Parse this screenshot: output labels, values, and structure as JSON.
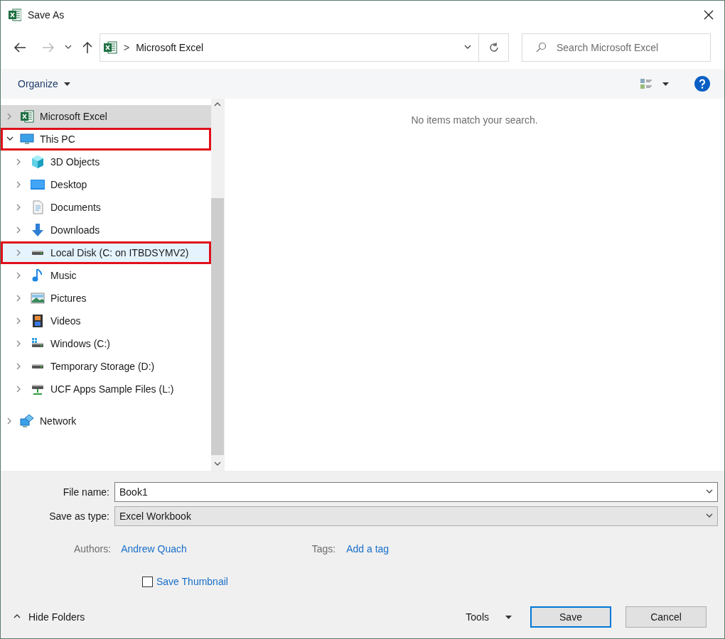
{
  "window": {
    "title": "Save As"
  },
  "address_bar": {
    "separator": ">",
    "location": "Microsoft Excel"
  },
  "search": {
    "placeholder": "Search Microsoft Excel"
  },
  "toolbar": {
    "organize": "Organize"
  },
  "nav_tree": [
    {
      "label": "Microsoft Excel",
      "kind": "excel",
      "expanded": false,
      "selected": true,
      "hot": false,
      "marked": false
    },
    {
      "label": "This PC",
      "kind": "pc",
      "expanded": true,
      "selected": false,
      "hot": false,
      "marked": true,
      "children": [
        {
          "label": "3D Objects",
          "kind": "objects3d",
          "expanded": false,
          "selected": false,
          "hot": false,
          "marked": false
        },
        {
          "label": "Desktop",
          "kind": "desktop",
          "expanded": false,
          "selected": false,
          "hot": false,
          "marked": false
        },
        {
          "label": "Documents",
          "kind": "documents",
          "expanded": false,
          "selected": false,
          "hot": false,
          "marked": false
        },
        {
          "label": "Downloads",
          "kind": "downloads",
          "expanded": false,
          "selected": false,
          "hot": false,
          "marked": false
        },
        {
          "label": "Local Disk (C: on ITBDSYMV2)",
          "kind": "disk",
          "expanded": false,
          "selected": false,
          "hot": true,
          "marked": true
        },
        {
          "label": "Music",
          "kind": "music",
          "expanded": false,
          "selected": false,
          "hot": false,
          "marked": false
        },
        {
          "label": "Pictures",
          "kind": "pictures",
          "expanded": false,
          "selected": false,
          "hot": false,
          "marked": false
        },
        {
          "label": "Videos",
          "kind": "videos",
          "expanded": false,
          "selected": false,
          "hot": false,
          "marked": false
        },
        {
          "label": "Windows (C:)",
          "kind": "windisk",
          "expanded": false,
          "selected": false,
          "hot": false,
          "marked": false
        },
        {
          "label": "Temporary Storage (D:)",
          "kind": "disk",
          "expanded": false,
          "selected": false,
          "hot": false,
          "marked": false
        },
        {
          "label": "UCF Apps Sample Files (L:)",
          "kind": "netdrive",
          "expanded": false,
          "selected": false,
          "hot": false,
          "marked": false
        }
      ]
    },
    {
      "label": "Network",
      "kind": "network",
      "expanded": false,
      "selected": false,
      "hot": false,
      "marked": false
    }
  ],
  "file_list": {
    "empty_message": "No items match your search."
  },
  "form": {
    "file_name": {
      "label": "File name:",
      "value": "Book1"
    },
    "save_as_type": {
      "label": "Save as type:",
      "value": "Excel Workbook"
    },
    "authors": {
      "label": "Authors:",
      "value": "Andrew Quach"
    },
    "tags": {
      "label": "Tags:",
      "value": "Add a tag"
    },
    "save_thumbnail": {
      "label": "Save Thumbnail",
      "checked": false
    }
  },
  "footer": {
    "hide_folders": "Hide Folders",
    "tools": "Tools",
    "save": "Save",
    "cancel": "Cancel"
  }
}
